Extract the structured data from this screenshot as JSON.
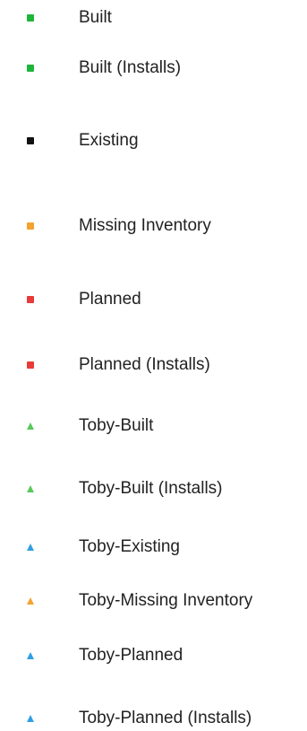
{
  "legend": {
    "items": [
      {
        "label": "Built",
        "shape": "square",
        "color": "#1fb53a"
      },
      {
        "label": "Built (Installs)",
        "shape": "square",
        "color": "#1fb53a"
      },
      {
        "label": "Existing",
        "shape": "square",
        "color": "#111111"
      },
      {
        "label": "Missing Inventory",
        "shape": "square",
        "color": "#f4a22e"
      },
      {
        "label": "Planned",
        "shape": "square",
        "color": "#e83a38"
      },
      {
        "label": "Planned (Installs)",
        "shape": "square",
        "color": "#e83a38"
      },
      {
        "label": "Toby-Built",
        "shape": "triangle",
        "color": "#58c95c"
      },
      {
        "label": "Toby-Built (Installs)",
        "shape": "triangle",
        "color": "#58c95c"
      },
      {
        "label": "Toby-Existing",
        "shape": "triangle",
        "color": "#2f9fe3"
      },
      {
        "label": "Toby-Missing Inventory",
        "shape": "triangle",
        "color": "#f4a22e"
      },
      {
        "label": "Toby-Planned",
        "shape": "triangle",
        "color": "#2f9fe3"
      },
      {
        "label": "Toby-Planned (Installs)",
        "shape": "triangle",
        "color": "#2f9fe3"
      }
    ]
  }
}
